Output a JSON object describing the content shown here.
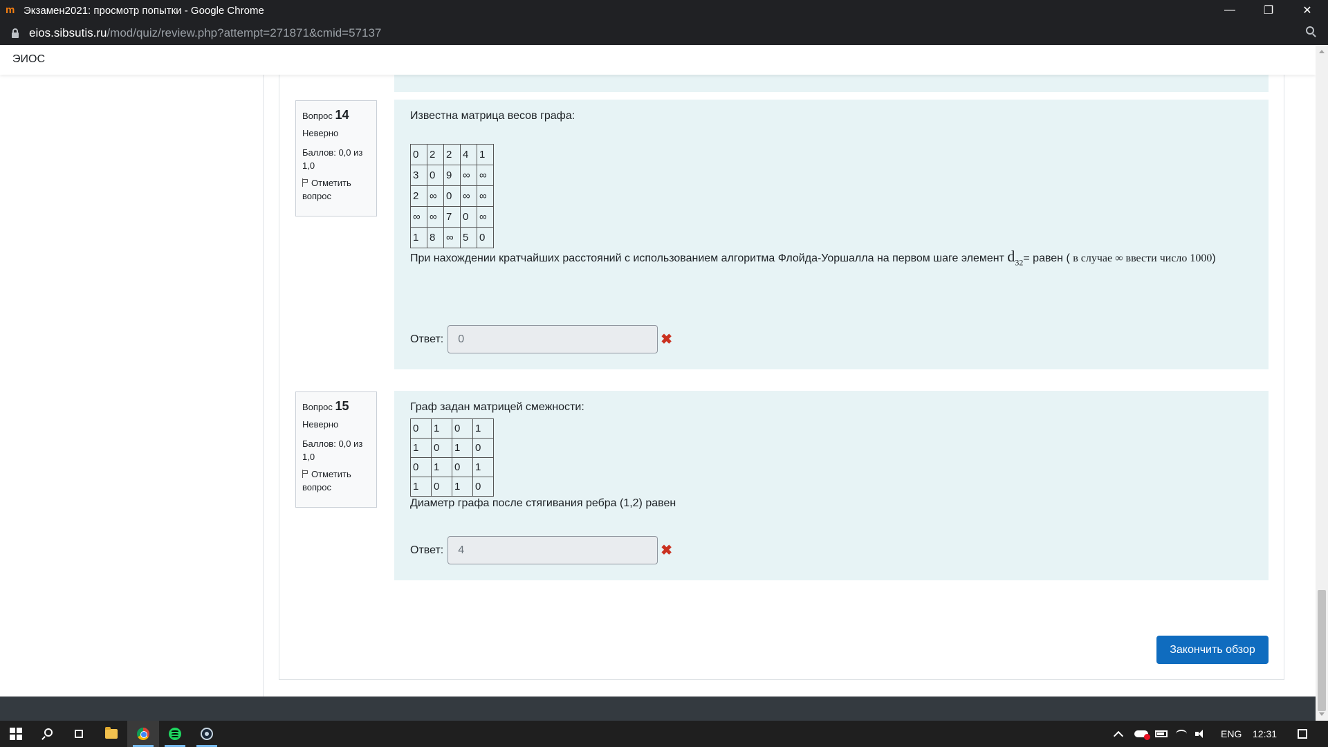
{
  "window": {
    "title": "Экзамен2021: просмотр попытки - Google Chrome",
    "app_logo": "m",
    "min_symbol": "—",
    "max_symbol": "❐",
    "close_symbol": "✕"
  },
  "address_bar": {
    "domain": "eios.sibsutis.ru",
    "path": "/mod/quiz/review.php?attempt=271871&cmid=57137"
  },
  "site": {
    "brand": "ЭИОС"
  },
  "questions": [
    {
      "label": "Вопрос",
      "number": "14",
      "state": "Неверно",
      "grade": "Баллов: 0,0 из 1,0",
      "flag_label": "Отметить вопрос",
      "intro": "Известна матрица весов графа:",
      "matrix": [
        [
          "0",
          "2",
          "2",
          "4",
          "1"
        ],
        [
          "3",
          "0",
          "9",
          "∞",
          "∞"
        ],
        [
          "2",
          "∞",
          "0",
          "∞",
          "∞"
        ],
        [
          "∞",
          "∞",
          "7",
          "0",
          "∞"
        ],
        [
          "1",
          "8",
          "∞",
          "5",
          "0"
        ]
      ],
      "text_before_element": "При нахождении кратчайших расстояний с использованием алгоритма Флойда-Уоршалла на первом шаге элемент ",
      "element_base": "d",
      "element_sub": "32",
      "text_after_element": "= равен ( ",
      "serif_note": "в случае ∞ ввести число 1000",
      "text_end": ")",
      "answer_label": "Ответ:",
      "answer_value": "0",
      "incorrect_symbol": "✖"
    },
    {
      "label": "Вопрос",
      "number": "15",
      "state": "Неверно",
      "grade": "Баллов: 0,0 из 1,0",
      "flag_label": "Отметить вопрос",
      "intro": "Граф задан матрицей смежности:",
      "matrix": [
        [
          "0",
          "1",
          "0",
          "1"
        ],
        [
          "1",
          "0",
          "1",
          "0"
        ],
        [
          "0",
          "1",
          "0",
          "1"
        ],
        [
          "1",
          "0",
          "1",
          "0"
        ]
      ],
      "outro": "Диаметр графа после стягивания ребра (1,2) равен",
      "answer_label": "Ответ:",
      "answer_value": "4",
      "incorrect_symbol": "✖"
    }
  ],
  "finish_button": "Закончить обзор",
  "taskbar": {
    "language": "ENG",
    "time": "12:31"
  },
  "colors": {
    "accent": "#0f6cbf",
    "question_bg": "#e7f3f5",
    "incorrect": "#ca3120",
    "chrome_dark": "#202124"
  }
}
